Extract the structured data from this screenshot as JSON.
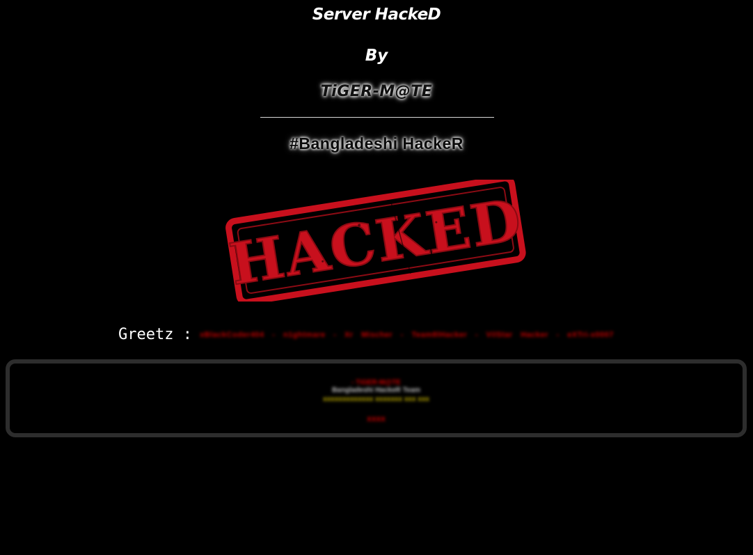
{
  "header": {
    "title": "Server HackeD",
    "by": "By",
    "author": "TiGER-M@TE",
    "tagline": "#Bangladeshi HackeR"
  },
  "stamp": {
    "text": "HACKED",
    "color": "#c8101d"
  },
  "greetz": {
    "label": "Greetz :",
    "names": "xBlackCoder404 - n1ghtmare - Xr Mischer - Team8lHacker - VilStar Hacker - eXTri-x0007"
  },
  "message_box": {
    "line1": "- TiGER-M@TE",
    "line2": "Bangladeshi HackeR Team",
    "line3": "xxxxxxxxxxxxx xxxxxxx xxx xxx",
    "line4": "xxxx"
  },
  "colors": {
    "background": "#000000",
    "accent_red": "#c8101d",
    "box_border": "#2d2d2d"
  }
}
